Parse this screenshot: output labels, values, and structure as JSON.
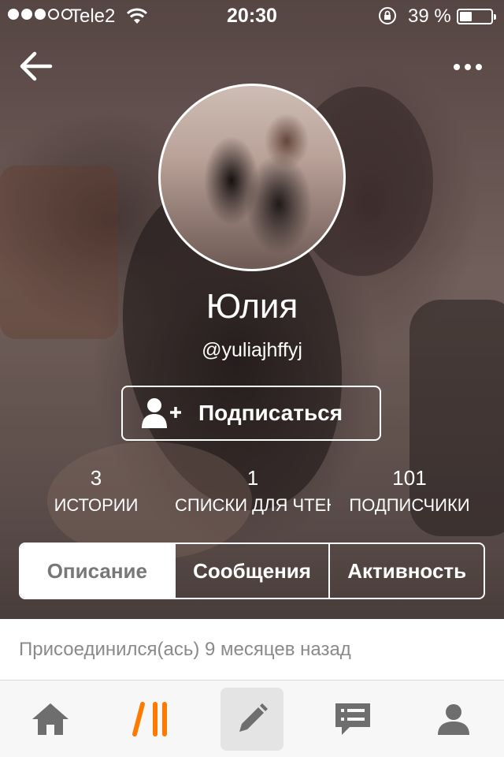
{
  "status_bar": {
    "carrier": "Tele2",
    "time": "20:30",
    "battery_percent": "39 %",
    "battery_level": 0.39,
    "signal_bars": 3,
    "signal_total": 5
  },
  "profile": {
    "name": "Юлия",
    "handle": "@yuliajhffyj",
    "follow_label": "Подписаться"
  },
  "stats": [
    {
      "value": "3",
      "label": "ИСТОРИИ"
    },
    {
      "value": "1",
      "label": "СПИСКИ ДЛЯ ЧТЕНИЯ"
    },
    {
      "value": "101",
      "label": "ПОДПИСЧИКИ"
    }
  ],
  "tabs": [
    {
      "label": "Описание",
      "active": true
    },
    {
      "label": "Сообщения",
      "active": false
    },
    {
      "label": "Активность",
      "active": false
    }
  ],
  "description": {
    "joined": "Присоединился(ась) 9 месяцев назад"
  },
  "bottom_nav": {
    "items": [
      "home-icon",
      "reading-icon",
      "pencil-icon",
      "messages-icon",
      "profile-icon"
    ],
    "active_color": "#ff7a00",
    "inactive_color": "#6e6e6e"
  }
}
